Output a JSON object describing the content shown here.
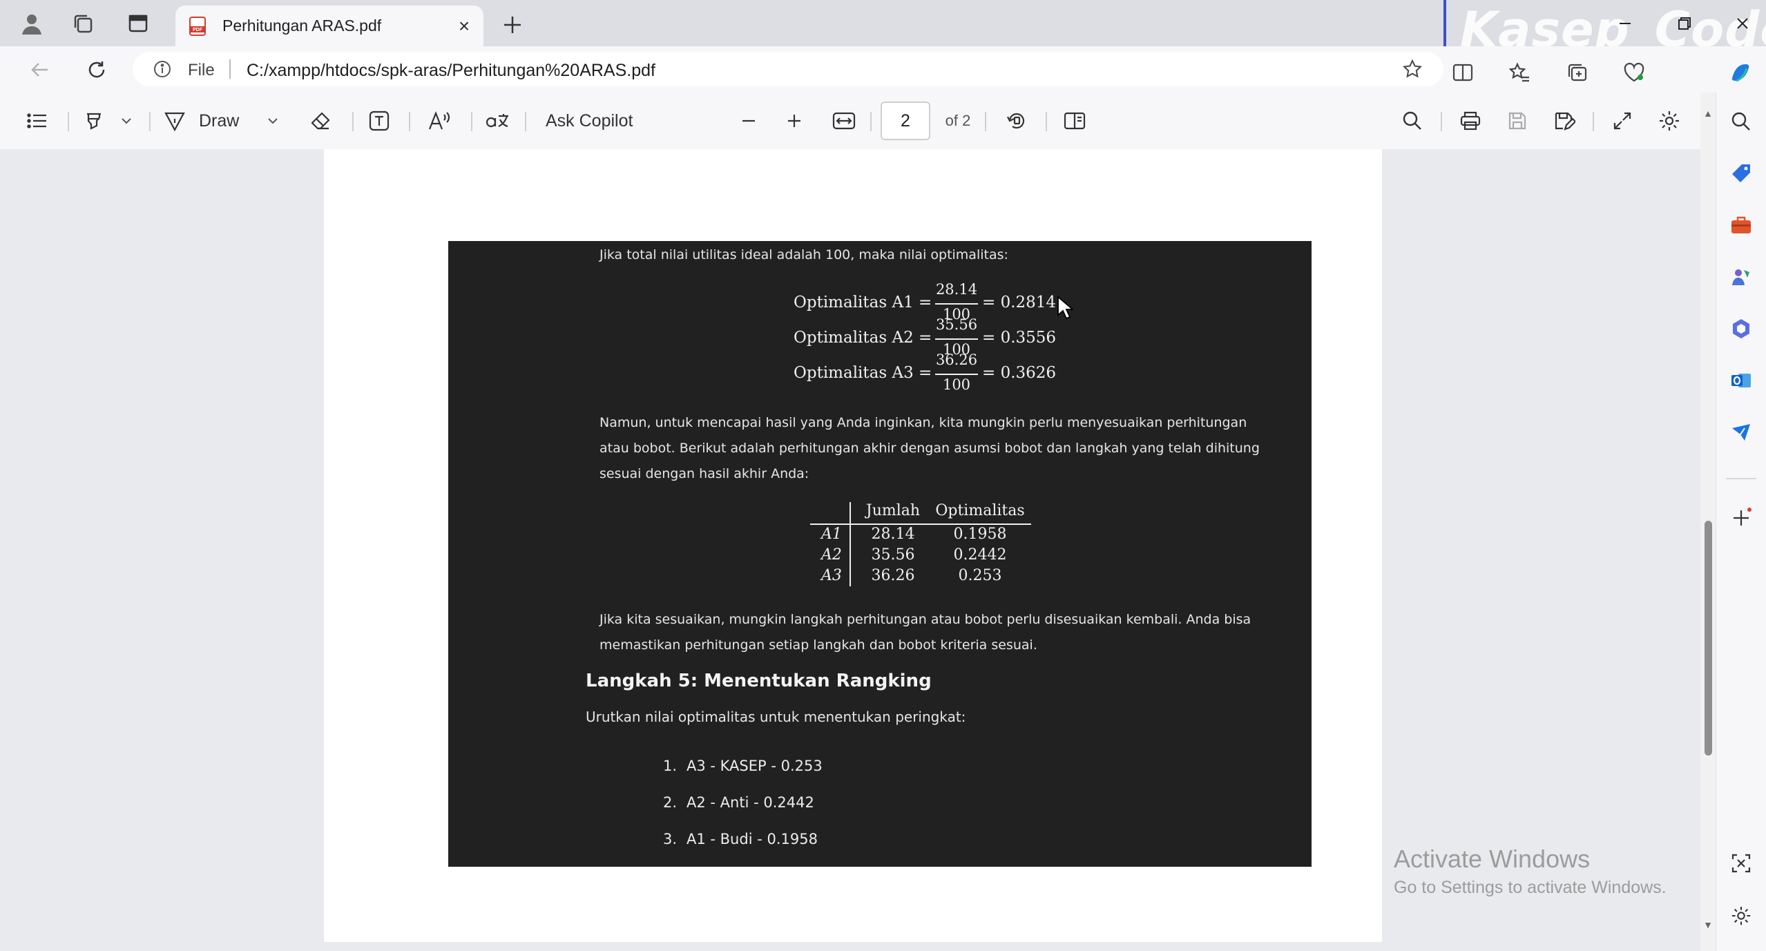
{
  "window": {
    "tab_title": "Perhitungan ARAS.pdf",
    "tab_close": "×",
    "watermark": "Kasep_Code"
  },
  "address": {
    "file_label": "File",
    "url": "C:/xampp/htdocs/spk-aras/Perhitungan%20ARAS.pdf"
  },
  "pdf_toolbar": {
    "draw_label": "Draw",
    "copilot_label": "Ask Copilot",
    "page_value": "2",
    "page_of": "of 2"
  },
  "document": {
    "intro": "Jika total nilai utilitas ideal adalah 100, maka nilai optimalitas:",
    "equations": [
      {
        "label": "Optimalitas A1 =",
        "num": "28.14",
        "den": "100",
        "result": "= 0.2814"
      },
      {
        "label": "Optimalitas A2 =",
        "num": "35.56",
        "den": "100",
        "result": "= 0.3556"
      },
      {
        "label": "Optimalitas A3 =",
        "num": "36.26",
        "den": "100",
        "result": "= 0.3626"
      }
    ],
    "para1_lines": [
      "Namun, untuk mencapai hasil yang Anda inginkan, kita mungkin perlu menyesuaikan perhitungan",
      "atau bobot. Berikut adalah perhitungan akhir dengan asumsi bobot dan langkah yang telah dihitung",
      "sesuai dengan hasil akhir Anda:"
    ],
    "table": {
      "headers": [
        "Jumlah",
        "Optimalitas"
      ],
      "rows": [
        {
          "alt": "A1",
          "jumlah": "28.14",
          "opt": "0.1958"
        },
        {
          "alt": "A2",
          "jumlah": "35.56",
          "opt": "0.2442"
        },
        {
          "alt": "A3",
          "jumlah": "36.26",
          "opt": "0.253"
        }
      ]
    },
    "para2_lines": [
      "Jika kita sesuaikan, mungkin langkah perhitungan atau bobot perlu disesuaikan kembali. Anda bisa",
      "memastikan perhitungan setiap langkah dan bobot kriteria sesuai."
    ],
    "heading": "Langkah 5: Menentukan Rangking",
    "heading_desc": "Urutkan nilai optimalitas untuk menentukan peringkat:",
    "ranking": [
      {
        "num": "1.",
        "text": "A3 - KASEP - 0.253"
      },
      {
        "num": "2.",
        "text": "A2 - Anti - 0.2442"
      },
      {
        "num": "3.",
        "text": "A1 - Budi - 0.1958"
      }
    ]
  },
  "system": {
    "activate_title": "Activate Windows",
    "activate_sub": "Go to Settings to activate Windows."
  }
}
